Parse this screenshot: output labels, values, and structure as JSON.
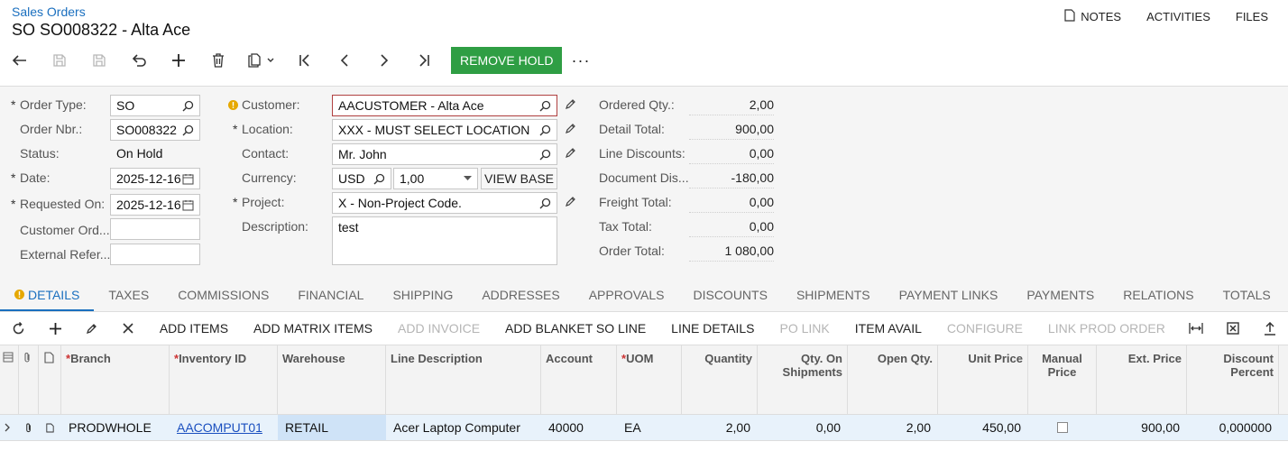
{
  "header": {
    "breadcrumb": "Sales Orders",
    "title": "SO SO008322 - Alta Ace",
    "links": [
      "NOTES",
      "ACTIVITIES",
      "FILES"
    ]
  },
  "toolbar": {
    "remove_hold": "REMOVE HOLD",
    "more": "···"
  },
  "form": {
    "order_type": {
      "label": "Order Type:",
      "value": "SO"
    },
    "order_nbr": {
      "label": "Order Nbr.:",
      "value": "SO008322"
    },
    "status": {
      "label": "Status:",
      "value": "On Hold"
    },
    "date": {
      "label": "Date:",
      "value": "2025-12-16"
    },
    "requested_on": {
      "label": "Requested On:",
      "value": "2025-12-16"
    },
    "customer_ord": {
      "label": "Customer Ord...",
      "value": ""
    },
    "external_ref": {
      "label": "External Refer...",
      "value": ""
    },
    "customer": {
      "label": "Customer:",
      "value": "AACUSTOMER - Alta Ace"
    },
    "location": {
      "label": "Location:",
      "value": "XXX - MUST SELECT LOCATION"
    },
    "contact": {
      "label": "Contact:",
      "value": "Mr. John"
    },
    "currency": {
      "label": "Currency:",
      "value": "USD",
      "rate": "1,00",
      "view_base": "VIEW BASE"
    },
    "project": {
      "label": "Project:",
      "value": "X - Non-Project Code."
    },
    "description": {
      "label": "Description:",
      "value": "test"
    }
  },
  "summary": [
    {
      "label": "Ordered Qty.:",
      "value": "2,00"
    },
    {
      "label": "Detail Total:",
      "value": "900,00"
    },
    {
      "label": "Line Discounts:",
      "value": "0,00"
    },
    {
      "label": "Document Dis...",
      "value": "-180,00"
    },
    {
      "label": "Freight Total:",
      "value": "0,00"
    },
    {
      "label": "Tax Total:",
      "value": "0,00"
    },
    {
      "label": "Order Total:",
      "value": "1 080,00"
    }
  ],
  "tabs": [
    "DETAILS",
    "TAXES",
    "COMMISSIONS",
    "FINANCIAL",
    "SHIPPING",
    "ADDRESSES",
    "APPROVALS",
    "DISCOUNTS",
    "SHIPMENTS",
    "PAYMENT LINKS",
    "PAYMENTS",
    "RELATIONS",
    "TOTALS"
  ],
  "grid_toolbar": {
    "add_items": "ADD ITEMS",
    "add_matrix_items": "ADD MATRIX ITEMS",
    "add_invoice": "ADD INVOICE",
    "add_blanket_so_line": "ADD BLANKET SO LINE",
    "line_details": "LINE DETAILS",
    "po_link": "PO LINK",
    "item_avail": "ITEM AVAIL",
    "configure": "CONFIGURE",
    "link_prod_order": "LINK PROD ORDER"
  },
  "grid": {
    "columns": {
      "branch": "Branch",
      "inventory_id": "Inventory ID",
      "warehouse": "Warehouse",
      "line_description": "Line Description",
      "account": "Account",
      "uom": "UOM",
      "quantity": "Quantity",
      "qty_on_shipments": "Qty. On Shipments",
      "open_qty": "Open Qty.",
      "unit_price": "Unit Price",
      "manual_price": "Manual Price",
      "ext_price": "Ext. Price",
      "discount_percent": "Discount Percent"
    },
    "rows": [
      {
        "branch": "PRODWHOLE",
        "inventory_id": "AACOMPUT01",
        "warehouse": "RETAIL",
        "line_description": "Acer Laptop Computer",
        "account": "40000",
        "uom": "EA",
        "quantity": "2,00",
        "qty_on_shipments": "0,00",
        "open_qty": "2,00",
        "unit_price": "450,00",
        "manual_price": false,
        "ext_price": "900,00",
        "discount_percent": "0,000000"
      }
    ]
  }
}
